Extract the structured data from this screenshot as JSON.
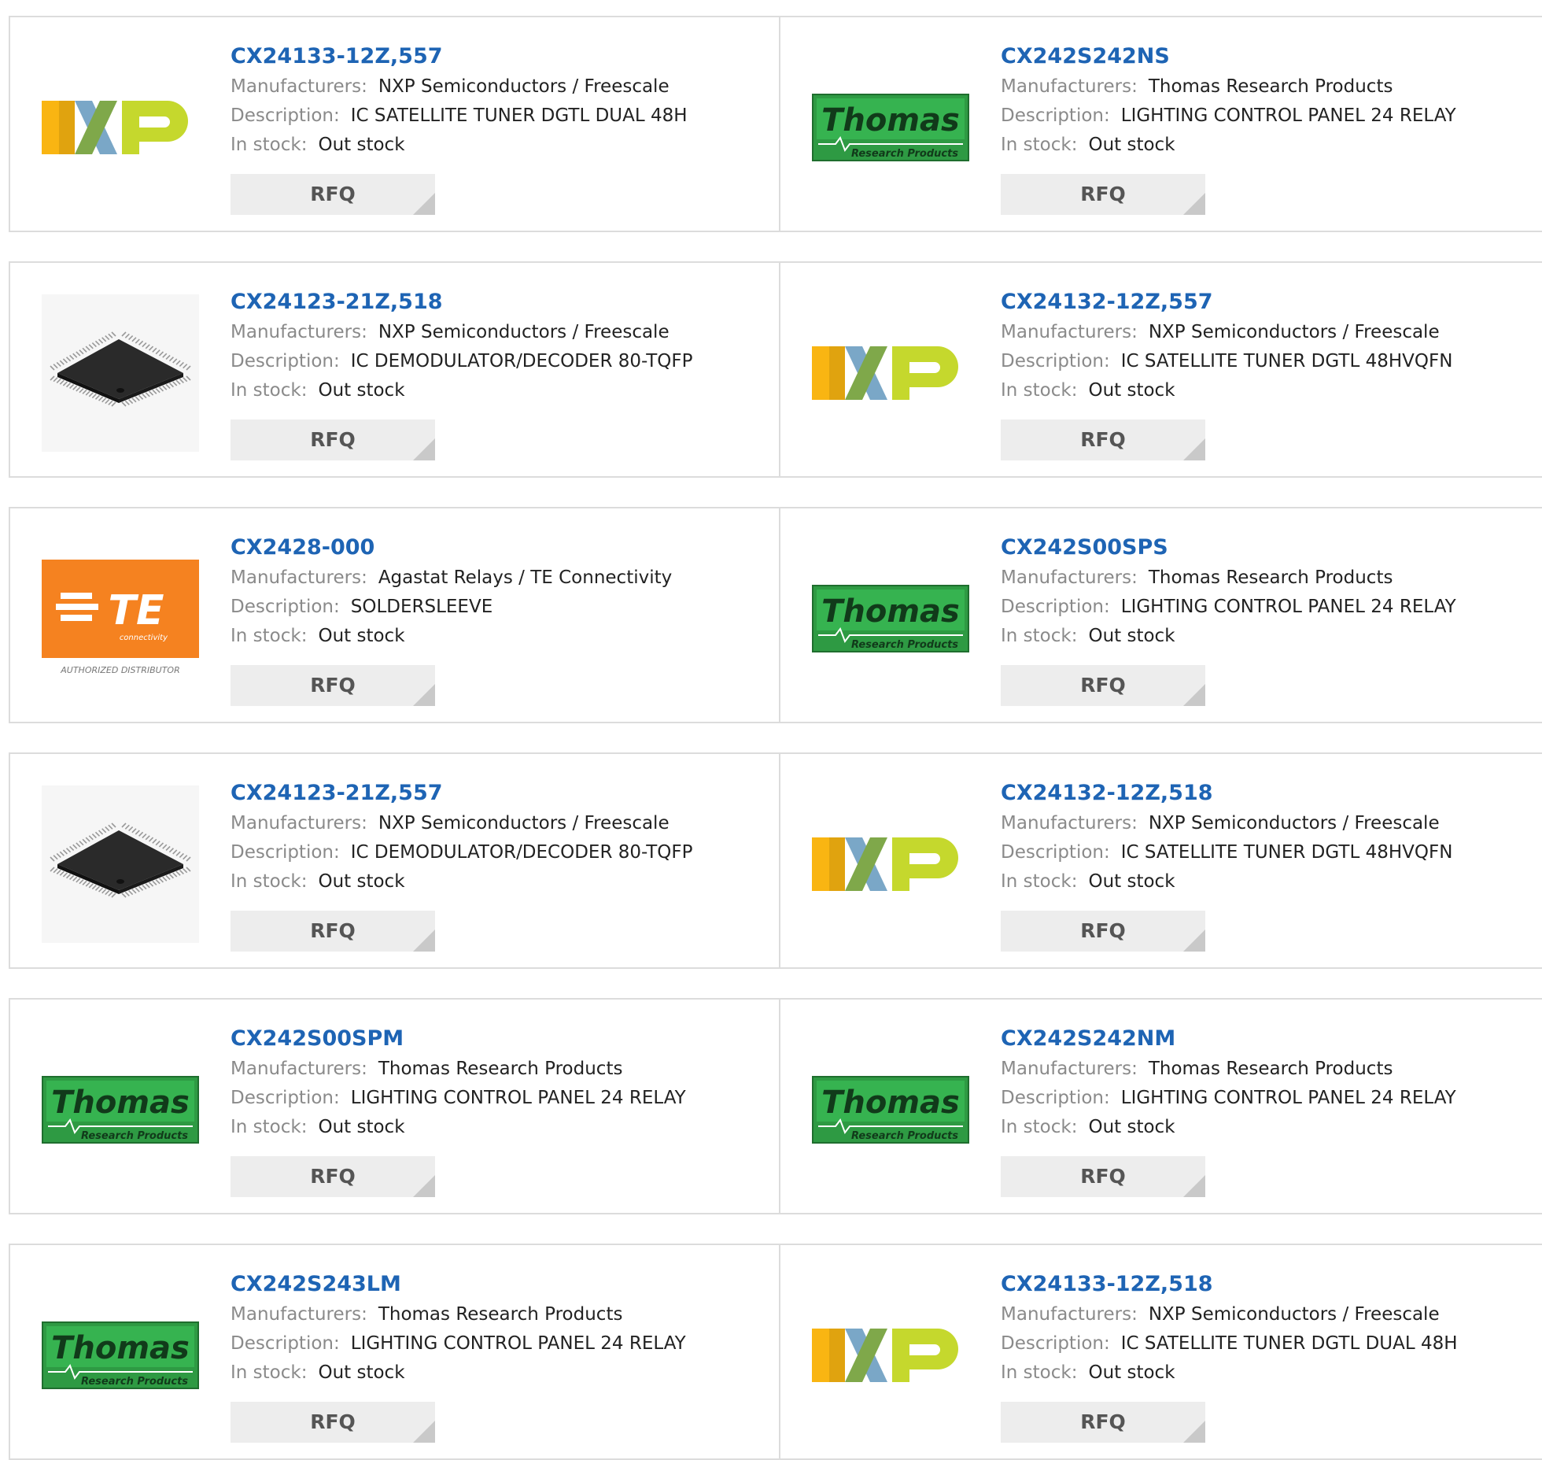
{
  "labels": {
    "manufacturers": "Manufacturers:",
    "description": "Description:",
    "in_stock": "In stock:",
    "rfq": "RFQ"
  },
  "colors": {
    "link": "#1e64b4",
    "border": "#dcdcdc",
    "button_bg": "#ededed"
  },
  "products": [
    {
      "part": "CX24133-12Z,557",
      "manufacturer": "NXP Semiconductors / Freescale",
      "description": "IC SATELLITE TUNER DGTL DUAL 48H",
      "stock": "Out stock",
      "logo": "nxp-logo"
    },
    {
      "part": "CX242S242NS",
      "manufacturer": "Thomas Research Products",
      "description": "LIGHTING CONTROL PANEL 24 RELAY",
      "stock": "Out stock",
      "logo": "thomas-logo"
    },
    {
      "part": "CX24123-21Z,518",
      "manufacturer": "NXP Semiconductors / Freescale",
      "description": "IC DEMODULATOR/DECODER 80-TQFP",
      "stock": "Out stock",
      "logo": "chip-image"
    },
    {
      "part": "CX24132-12Z,557",
      "manufacturer": "NXP Semiconductors / Freescale",
      "description": "IC SATELLITE TUNER DGTL 48HVQFN",
      "stock": "Out stock",
      "logo": "nxp-logo"
    },
    {
      "part": "CX2428-000",
      "manufacturer": "Agastat Relays / TE Connectivity",
      "description": "SOLDERSLEEVE",
      "stock": "Out stock",
      "logo": "te-logo",
      "logo_text": {
        "connectivity": "connectivity",
        "authorized": "AUTHORIZED DISTRIBUTOR"
      }
    },
    {
      "part": "CX242S00SPS",
      "manufacturer": "Thomas Research Products",
      "description": "LIGHTING CONTROL PANEL 24 RELAY",
      "stock": "Out stock",
      "logo": "thomas-logo"
    },
    {
      "part": "CX24123-21Z,557",
      "manufacturer": "NXP Semiconductors / Freescale",
      "description": "IC DEMODULATOR/DECODER 80-TQFP",
      "stock": "Out stock",
      "logo": "chip-image"
    },
    {
      "part": "CX24132-12Z,518",
      "manufacturer": "NXP Semiconductors / Freescale",
      "description": "IC SATELLITE TUNER DGTL 48HVQFN",
      "stock": "Out stock",
      "logo": "nxp-logo"
    },
    {
      "part": "CX242S00SPM",
      "manufacturer": "Thomas Research Products",
      "description": "LIGHTING CONTROL PANEL 24 RELAY",
      "stock": "Out stock",
      "logo": "thomas-logo"
    },
    {
      "part": "CX242S242NM",
      "manufacturer": "Thomas Research Products",
      "description": "LIGHTING CONTROL PANEL 24 RELAY",
      "stock": "Out stock",
      "logo": "thomas-logo"
    },
    {
      "part": "CX242S243LM",
      "manufacturer": "Thomas Research Products",
      "description": "LIGHTING CONTROL PANEL 24 RELAY",
      "stock": "Out stock",
      "logo": "thomas-logo"
    },
    {
      "part": "CX24133-12Z,518",
      "manufacturer": "NXP Semiconductors / Freescale",
      "description": "IC SATELLITE TUNER DGTL DUAL 48H",
      "stock": "Out stock",
      "logo": "nxp-logo"
    }
  ]
}
